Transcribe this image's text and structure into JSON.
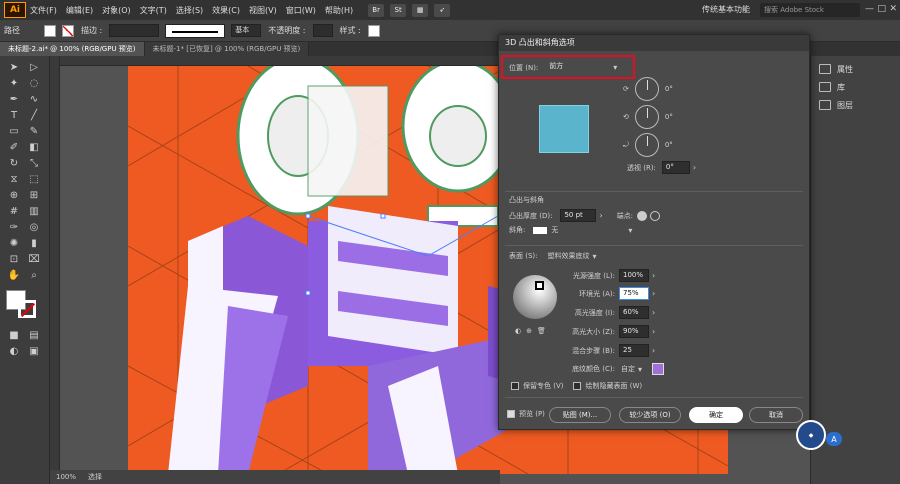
{
  "menubar": {
    "logo": "Ai",
    "items": [
      "文件(F)",
      "编辑(E)",
      "对象(O)",
      "文字(T)",
      "选择(S)",
      "效果(C)",
      "视图(V)",
      "窗口(W)",
      "帮助(H)"
    ],
    "workspace": "传统基本功能",
    "search_placeholder": "搜索 Adobe Stock"
  },
  "controlbar": {
    "label": "路径",
    "stroke_label": "描边 :",
    "stroke_style": "基本",
    "opacity_label": "不透明度 :",
    "style_label": "样式 :"
  },
  "tabs": [
    {
      "label": "未标题-2.ai* @ 100% (RGB/GPU 预览)",
      "active": true
    },
    {
      "label": "未标题-1* [已恢复] @ 100% (RGB/GPU 预览)",
      "active": false
    }
  ],
  "statusbar": {
    "zoom": "100%",
    "tool": "选择"
  },
  "rightpanel": {
    "items": [
      "属性",
      "库",
      "图层"
    ]
  },
  "dialog": {
    "title": "3D 凸出和斜角选项",
    "position_label": "位置 (N):",
    "position_value": "前方",
    "rotation": [
      "0°",
      "0°",
      "0°"
    ],
    "perspective_label": "透视 (R):",
    "perspective_value": "0°",
    "extrude_section": "凸出与斜角",
    "extrude_depth_label": "凸出厚度 (D):",
    "extrude_depth_value": "50 pt",
    "cap_label": "端点:",
    "bevel_label": "斜角:",
    "bevel_value": "无",
    "surface_label": "表面 (S):",
    "surface_value": "塑料效果底纹",
    "light_intensity_label": "光源强度 (L):",
    "light_intensity_value": "100%",
    "ambient_label": "环境光 (A):",
    "ambient_value": "75%",
    "highlight_intensity_label": "高光强度 (I):",
    "highlight_intensity_value": "60%",
    "highlight_size_label": "高光大小 (Z):",
    "highlight_size_value": "90%",
    "blend_steps_label": "混合步骤 (B):",
    "blend_steps_value": "25",
    "shading_color_label": "底纹颜色 (C):",
    "shading_color_value": "自定",
    "shading_color": "#a070d8",
    "preserve_spot_label": "保留专色 (V)",
    "draw_hidden_label": "绘制隐藏表面 (W)",
    "preview_label": "预览 (P)",
    "map_button": "贴图 (M)...",
    "fewer_options_button": "较少选项 (O)",
    "ok_button": "确定",
    "cancel_button": "取消"
  }
}
